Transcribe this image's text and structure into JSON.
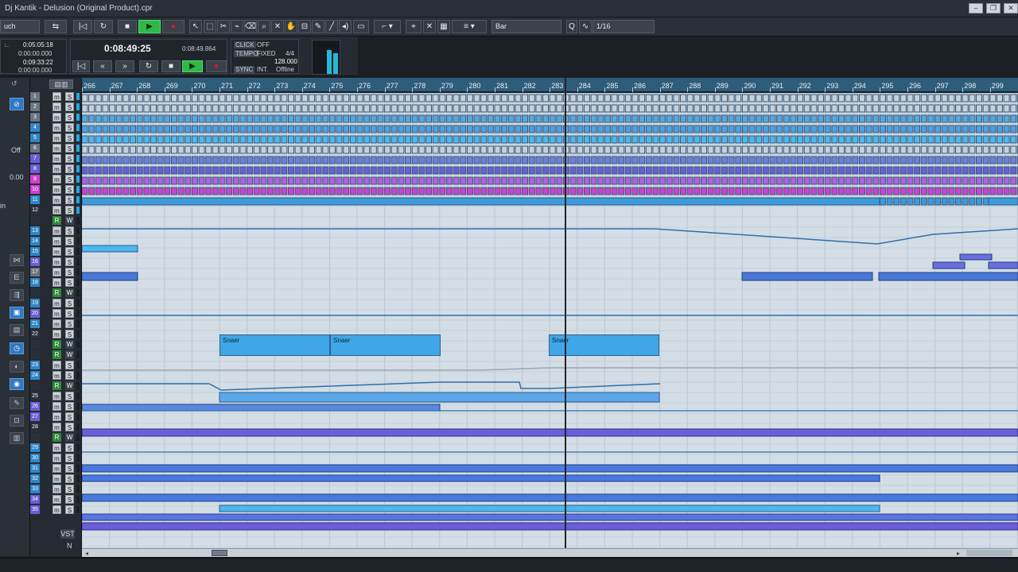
{
  "window": {
    "title": "Dj Kantik - Delusion (Original Product).cpr",
    "buttons": [
      "‒",
      "❐",
      "✕"
    ]
  },
  "toolbar": {
    "automation_mode": "uch",
    "snap_type": "Bar",
    "quantize": "1/16",
    "quantize_label": "Q"
  },
  "transport": {
    "position_secondary": "0:05:05:18",
    "position_offset": "0:00:00.000",
    "position_tertiary": "0:09:33:22",
    "position_offset2": "0:00:00.000",
    "main_time": "0:08:49:25",
    "sub_time": "0:08:49.864",
    "click_label": "CLICK",
    "click_value": "OFF",
    "tempo_label": "TEMPO",
    "tempo_mode": "FIXED",
    "signature": "4/4",
    "tempo_value": "128.000",
    "sync_label": "SYNC",
    "sync_mode": "INT.",
    "sync_status": "Offline"
  },
  "ruler": {
    "bars": [
      "266",
      "267",
      "268",
      "269",
      "270",
      "271",
      "272",
      "273",
      "274",
      "275",
      "276",
      "277",
      "278",
      "279",
      "280",
      "281",
      "282",
      "283",
      "284",
      "285",
      "286",
      "287",
      "288",
      "289",
      "290",
      "291",
      "292",
      "293",
      "294",
      "295",
      "296",
      "297",
      "298",
      "299"
    ]
  },
  "left_zone": {
    "off_label": "Off",
    "value_label": "0.00",
    "in_label": "in"
  },
  "tracks": {
    "numbers": [
      "1",
      "2",
      "3",
      "4",
      "5",
      "6",
      "7",
      "8",
      "9",
      "10",
      "11",
      "12",
      "",
      "13",
      "14",
      "15",
      "16",
      "17",
      "18",
      "",
      "19",
      "20",
      "21",
      "22",
      "",
      "",
      "23",
      "24",
      "",
      "25",
      "26",
      "27",
      "28",
      "",
      "29",
      "30",
      "31",
      "32",
      "33",
      "34",
      "35"
    ]
  },
  "parts": {
    "snare_label": "Snaer"
  },
  "footer": {
    "vst_label": "VST",
    "n_label": "N"
  },
  "colors": {
    "accent_blue": "#2f86c8",
    "light_blue": "#4fb6ee",
    "purple": "#6a5fd6",
    "magenta": "#d040d0",
    "green_play": "#2fb84a",
    "rec_red": "#e01818"
  }
}
